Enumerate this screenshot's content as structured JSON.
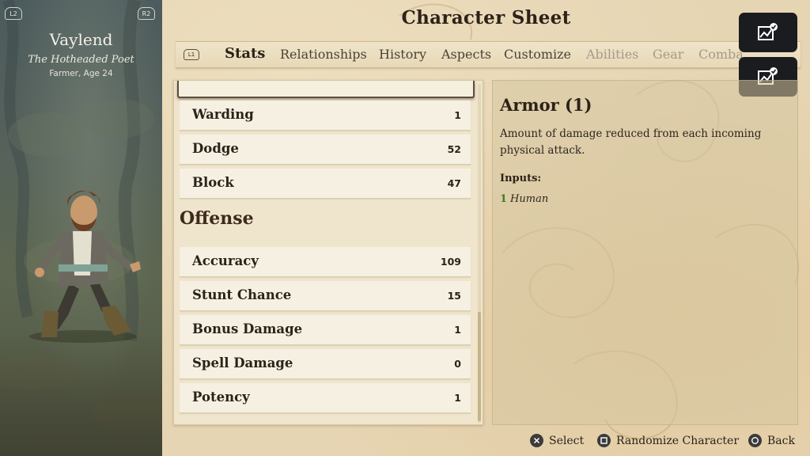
{
  "character": {
    "name": "Vaylend",
    "title": "The Hotheaded Poet",
    "subtitle": "Farmer, Age 24",
    "trigger_left": "L2",
    "trigger_right": "R2"
  },
  "header": {
    "title": "Character Sheet",
    "bumper_left": "L1"
  },
  "tabs": [
    {
      "label": "Stats",
      "state": "active"
    },
    {
      "label": "Relationships",
      "state": "normal"
    },
    {
      "label": "History",
      "state": "normal"
    },
    {
      "label": "Aspects",
      "state": "normal"
    },
    {
      "label": "Customize",
      "state": "normal"
    },
    {
      "label": "Abilities",
      "state": "disabled"
    },
    {
      "label": "Gear",
      "state": "disabled"
    },
    {
      "label": "Combat",
      "state": "disabled"
    }
  ],
  "stats": {
    "defense_rows": [
      {
        "label": "Warding",
        "value": "1"
      },
      {
        "label": "Dodge",
        "value": "52"
      },
      {
        "label": "Block",
        "value": "47"
      }
    ],
    "offense_heading": "Offense",
    "offense_rows": [
      {
        "label": "Accuracy",
        "value": "109"
      },
      {
        "label": "Stunt Chance",
        "value": "15"
      },
      {
        "label": "Bonus Damage",
        "value": "1"
      },
      {
        "label": "Spell Damage",
        "value": "0"
      },
      {
        "label": "Potency",
        "value": "1"
      }
    ]
  },
  "detail": {
    "title": "Armor (1)",
    "description": "Amount of damage reduced from each incoming physical attack.",
    "inputs_label": "Inputs:",
    "inputs": [
      {
        "value": "1",
        "source": "Human"
      }
    ]
  },
  "footer": {
    "select_label": "Select",
    "randomize_label": "Randomize Character",
    "back_label": "Back"
  },
  "colors": {
    "parchment": "#e6d5b3",
    "ink": "#2c2218",
    "positive_input": "#3f7a2c",
    "overlay_button": "#1b1c1f"
  },
  "icons": {
    "overlay_button": "chart-check-icon",
    "select": "cross-button-icon",
    "randomize": "square-button-icon",
    "back": "circle-button-icon"
  }
}
